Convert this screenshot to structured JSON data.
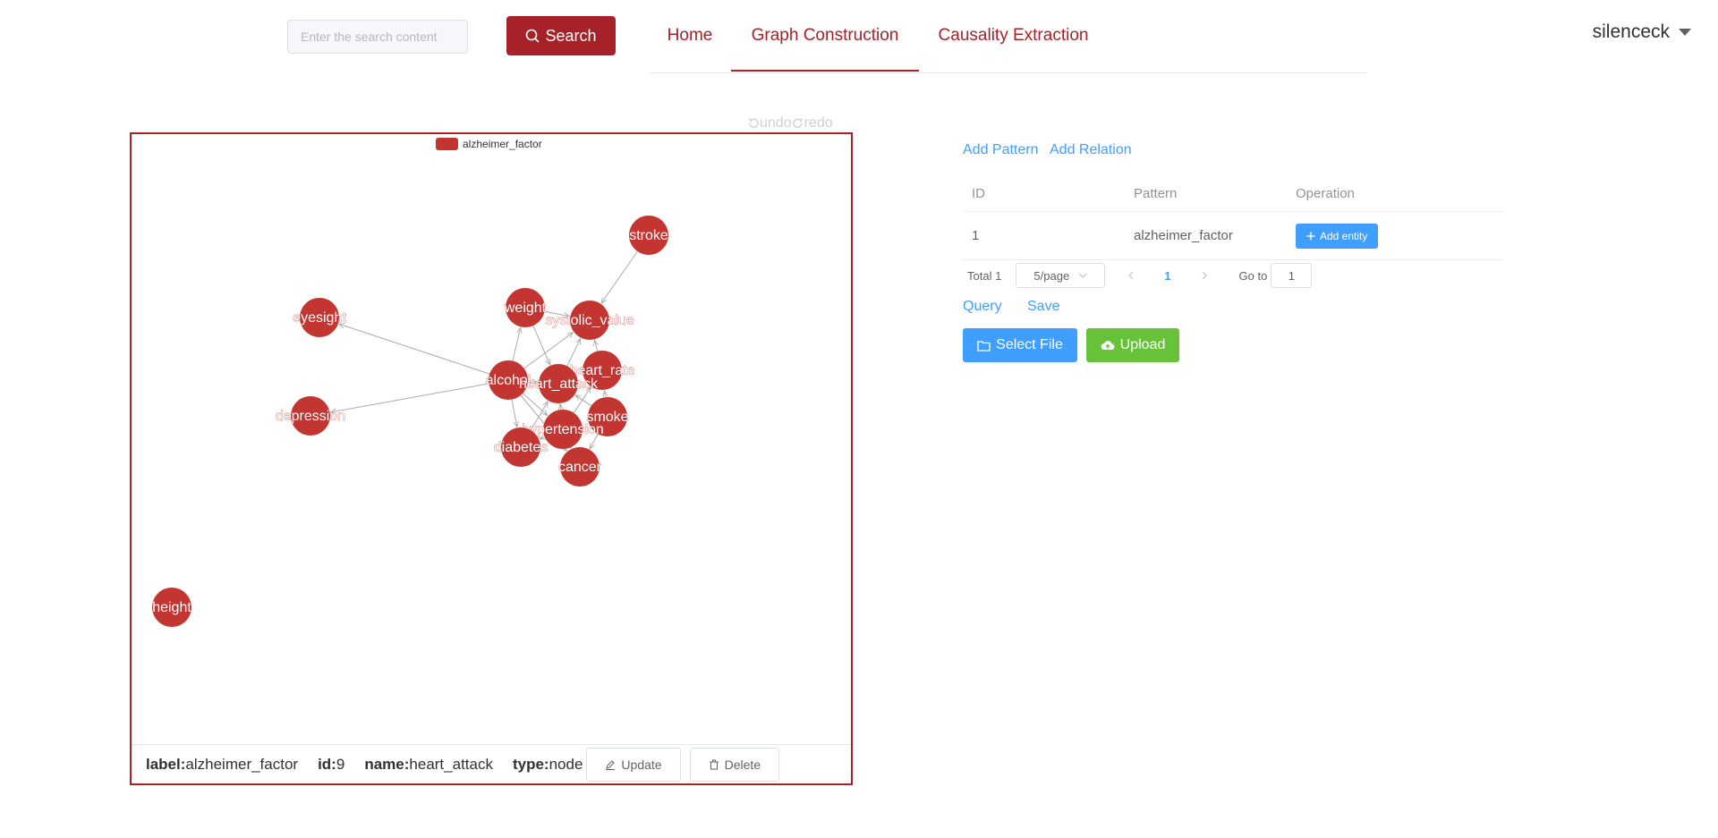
{
  "header": {
    "search": {
      "placeholder": "Enter the search content",
      "value": "",
      "button_label": "Search"
    },
    "nav": [
      {
        "label": "Home",
        "active": false
      },
      {
        "label": "Graph Construction",
        "active": true
      },
      {
        "label": "Causality Extraction",
        "active": false
      }
    ],
    "user": {
      "name": "silenceck"
    }
  },
  "graph": {
    "controls": {
      "undo_label": "undo",
      "redo_label": "redo"
    },
    "legend": {
      "label": "alzheimer_factor",
      "color": "#c23531"
    },
    "node_color": "#c23531",
    "edge_color": "#aaaaaa",
    "nodes": [
      {
        "name": "stroke"
      },
      {
        "name": "weight"
      },
      {
        "name": "systolic_value"
      },
      {
        "name": "eyesight"
      },
      {
        "name": "heart_rate"
      },
      {
        "name": "alcohol"
      },
      {
        "name": "heart_attack"
      },
      {
        "name": "depression"
      },
      {
        "name": "smoke"
      },
      {
        "name": "hypertension"
      },
      {
        "name": "diabetes"
      },
      {
        "name": "cancer"
      },
      {
        "name": "height"
      }
    ],
    "edges": [
      {
        "source": "stroke",
        "target": "systolic_value"
      },
      {
        "source": "alcohol",
        "target": "eyesight"
      },
      {
        "source": "alcohol",
        "target": "depression"
      },
      {
        "source": "alcohol",
        "target": "weight"
      },
      {
        "source": "alcohol",
        "target": "systolic_value"
      },
      {
        "source": "alcohol",
        "target": "heart_attack"
      },
      {
        "source": "alcohol",
        "target": "diabetes"
      },
      {
        "source": "alcohol",
        "target": "hypertension"
      },
      {
        "source": "alcohol",
        "target": "cancer"
      },
      {
        "source": "weight",
        "target": "systolic_value"
      },
      {
        "source": "weight",
        "target": "heart_attack"
      },
      {
        "source": "heart_attack",
        "target": "systolic_value"
      },
      {
        "source": "heart_rate",
        "target": "systolic_value"
      },
      {
        "source": "smoke",
        "target": "heart_rate"
      },
      {
        "source": "smoke",
        "target": "heart_attack"
      },
      {
        "source": "smoke",
        "target": "cancer"
      },
      {
        "source": "hypertension",
        "target": "heart_attack"
      },
      {
        "source": "hypertension",
        "target": "diabetes"
      },
      {
        "source": "hypertension",
        "target": "cancer"
      },
      {
        "source": "hypertension",
        "target": "heart_rate"
      },
      {
        "source": "diabetes",
        "target": "heart_attack"
      }
    ]
  },
  "info_bar": {
    "label_key": "label:",
    "label_value": "alzheimer_factor",
    "id_key": "id:",
    "id_value": "9",
    "name_key": "name:",
    "name_value": "heart_attack",
    "type_key": "type:",
    "type_value": "node",
    "update_label": "Update",
    "delete_label": "Delete"
  },
  "patterns": {
    "add_pattern_label": "Add Pattern",
    "add_relation_label": "Add Relation",
    "columns": [
      "ID",
      "Pattern",
      "Operation"
    ],
    "rows": [
      {
        "id": "1",
        "pattern": "alzheimer_factor",
        "operation_label": "Add entity"
      }
    ],
    "pagination": {
      "total_label": "Total 1",
      "page_size": "5/page",
      "current_page": "1",
      "goto_label": "Go to",
      "goto_value": "1"
    },
    "query_label": "Query",
    "save_label": "Save",
    "select_file_label": "Select File",
    "upload_label": "Upload"
  }
}
